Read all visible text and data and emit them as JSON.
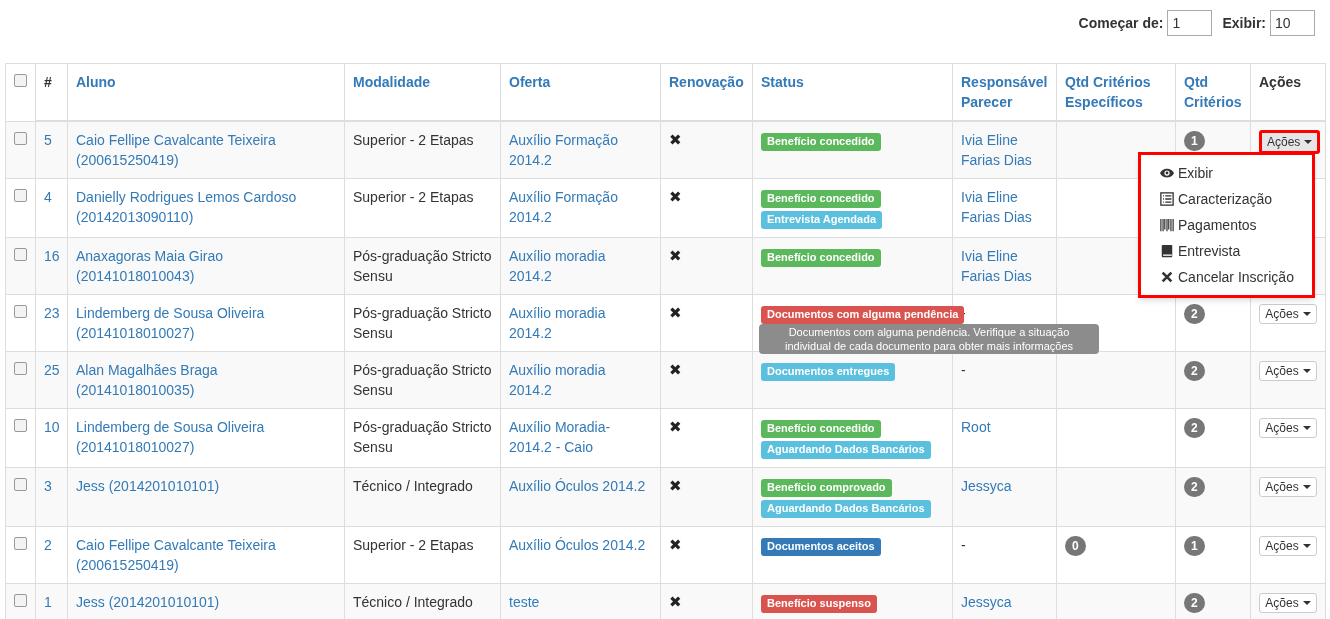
{
  "pagination": {
    "start_label": "Começar de:",
    "start_value": "1",
    "show_label": "Exibir:",
    "show_value": "10"
  },
  "table": {
    "select_all_checked": false,
    "columns": [
      {
        "label": "#",
        "kind": "plain"
      },
      {
        "label": "Aluno",
        "kind": "sort"
      },
      {
        "label": "Modalidade",
        "kind": "sort"
      },
      {
        "label": "Oferta",
        "kind": "sort"
      },
      {
        "label": "Renovação",
        "kind": "sort"
      },
      {
        "label": "Status",
        "kind": "sort"
      },
      {
        "label": "Responsável Parecer",
        "kind": "sort"
      },
      {
        "label": "Qtd Critérios Específicos",
        "kind": "sort"
      },
      {
        "label": "Qtd Critérios",
        "kind": "sort"
      },
      {
        "label": "Ações",
        "kind": "plain"
      }
    ],
    "rows": [
      {
        "checked": false,
        "id": "5",
        "aluno": "Caio Fellipe Cavalcante Teixeira (200615250419)",
        "modalidade": "Superior - 2 Etapas",
        "oferta": "Auxílio Formação 2014.2",
        "renovacao": "✖",
        "status": [
          {
            "text": "Benefício concedido",
            "color": "#5cb85c"
          }
        ],
        "responsavel": {
          "text": "Ivia Eline Farias Dias",
          "kind": "link"
        },
        "qtd_especificos": null,
        "qtd": "1",
        "action": "Ações",
        "menu_open": true
      },
      {
        "checked": false,
        "id": "4",
        "aluno": "Danielly Rodrigues Lemos Cardoso (20142013090110)",
        "modalidade": "Superior - 2 Etapas",
        "oferta": "Auxílio Formação 2014.2",
        "renovacao": "✖",
        "status": [
          {
            "text": "Benefício concedido",
            "color": "#5cb85c"
          },
          {
            "text": "Entrevista Agendada",
            "color": "#5bc0de"
          }
        ],
        "responsavel": {
          "text": "Ivia Eline Farias Dias",
          "kind": "link"
        },
        "qtd_especificos": null,
        "qtd": null,
        "action": null
      },
      {
        "checked": false,
        "id": "16",
        "aluno": "Anaxagoras Maia Girao (20141018010043)",
        "modalidade": "Pós-graduação Stricto Sensu",
        "oferta": "Auxílio moradia 2014.2",
        "renovacao": "✖",
        "status": [
          {
            "text": "Benefício concedido",
            "color": "#5cb85c"
          }
        ],
        "responsavel": {
          "text": "Ivia Eline Farias Dias",
          "kind": "link"
        },
        "qtd_especificos": null,
        "qtd": null,
        "action": null
      },
      {
        "checked": false,
        "id": "23",
        "aluno": "Lindemberg de Sousa Oliveira (20141018010027)",
        "modalidade": "Pós-graduação Stricto Sensu",
        "oferta": "Auxílio moradia 2014.2",
        "renovacao": "✖",
        "status": [
          {
            "text": "Documentos com alguma pendência",
            "color": "#d9534f"
          }
        ],
        "tooltip": "Documentos com alguma pendência. Verifique a situação individual de cada documento para obter mais informações",
        "responsavel": {
          "text": "-",
          "kind": "plain"
        },
        "qtd_especificos": null,
        "qtd": "2",
        "action": "Ações",
        "menu_open": false
      },
      {
        "checked": false,
        "id": "25",
        "aluno": "Alan Magalhães Braga (20141018010035)",
        "modalidade": "Pós-graduação Stricto Sensu",
        "oferta": "Auxílio moradia 2014.2",
        "renovacao": "✖",
        "status": [
          {
            "text": "Documentos entregues",
            "color": "#5bc0de"
          }
        ],
        "responsavel": {
          "text": "-",
          "kind": "plain"
        },
        "qtd_especificos": null,
        "qtd": "2",
        "action": "Ações",
        "menu_open": false
      },
      {
        "checked": false,
        "id": "10",
        "aluno": "Lindemberg de Sousa Oliveira (20141018010027)",
        "modalidade": "Pós-graduação Stricto Sensu",
        "oferta": "Auxílio Moradia-2014.2 - Caio",
        "renovacao": "✖",
        "status": [
          {
            "text": "Benefício concedido",
            "color": "#5cb85c"
          },
          {
            "text": "Aguardando Dados Bancários",
            "color": "#5bc0de"
          }
        ],
        "responsavel": {
          "text": "Root",
          "kind": "link"
        },
        "qtd_especificos": null,
        "qtd": "2",
        "action": "Ações",
        "menu_open": false
      },
      {
        "checked": false,
        "id": "3",
        "aluno": "Jess (2014201010101)",
        "modalidade": "Técnico / Integrado",
        "oferta": "Auxílio Óculos 2014.2",
        "renovacao": "✖",
        "status": [
          {
            "text": "Benefício comprovado",
            "color": "#5cb85c"
          },
          {
            "text": "Aguardando Dados Bancários",
            "color": "#5bc0de"
          }
        ],
        "responsavel": {
          "text": "Jessyca",
          "kind": "link"
        },
        "qtd_especificos": null,
        "qtd": "2",
        "action": "Ações",
        "menu_open": false
      },
      {
        "checked": false,
        "id": "2",
        "aluno": "Caio Fellipe Cavalcante Teixeira (200615250419)",
        "modalidade": "Superior - 2 Etapas",
        "oferta": "Auxílio Óculos 2014.2",
        "renovacao": "✖",
        "status": [
          {
            "text": "Documentos aceitos",
            "color": "#337ab7"
          }
        ],
        "responsavel": {
          "text": "-",
          "kind": "plain"
        },
        "qtd_especificos": "0",
        "qtd": "1",
        "action": "Ações",
        "menu_open": false
      },
      {
        "checked": false,
        "id": "1",
        "aluno": "Jess (2014201010101)",
        "modalidade": "Técnico / Integrado",
        "oferta": "teste",
        "renovacao": "✖",
        "status": [
          {
            "text": "Benefício suspenso",
            "color": "#d9534f"
          }
        ],
        "responsavel": {
          "text": "Jessyca",
          "kind": "link"
        },
        "qtd_especificos": null,
        "qtd": "2",
        "action": "Ações",
        "menu_open": false
      }
    ]
  },
  "dropdown": {
    "highlighted": true,
    "items": [
      {
        "kind": "eye",
        "label": "Exibir"
      },
      {
        "kind": "list",
        "label": "Caracterização"
      },
      {
        "kind": "bars",
        "label": "Pagamentos"
      },
      {
        "kind": "book",
        "label": "Entrevista"
      },
      {
        "kind": "cross",
        "label": "Cancelar Inscrição"
      }
    ]
  }
}
